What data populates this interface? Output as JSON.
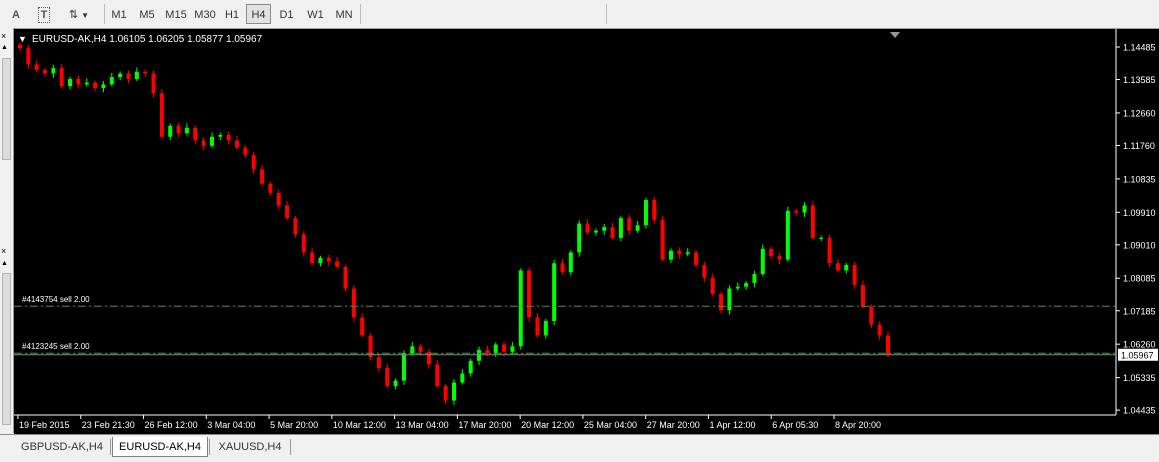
{
  "toolbar": {
    "tools": [
      {
        "name": "text-tool",
        "glyph": "A"
      },
      {
        "name": "text-label-tool",
        "glyph": "T"
      },
      {
        "name": "arrows-tool",
        "glyph": "⇅"
      }
    ],
    "timeframes": [
      "M1",
      "M5",
      "M15",
      "M30",
      "H1",
      "H4",
      "D1",
      "W1",
      "MN"
    ],
    "active_timeframe": "H4"
  },
  "chart": {
    "header": "EURUSD-AK,H4  1.06105 1.06205 1.05877 1.05967",
    "current_price": "1.05967",
    "price_levels": [
      "1.14485",
      "1.13585",
      "1.12660",
      "1.11760",
      "1.10835",
      "1.09910",
      "1.09010",
      "1.08085",
      "1.07185",
      "1.06260",
      "1.05335",
      "1.04435"
    ],
    "time_labels": [
      "19 Feb 2015",
      "23 Feb 21:30",
      "26 Feb 12:00",
      "3 Mar 04:00",
      "5 Mar 20:00",
      "10 Mar 12:00",
      "13 Mar 04:00",
      "17 Mar 20:00",
      "20 Mar 12:00",
      "25 Mar 04:00",
      "27 Mar 20:00",
      "1 Apr 12:00",
      "6 Apr 05:30",
      "8 Apr 20:00"
    ],
    "orders": [
      {
        "label": "#4143754 sell 2.00",
        "price": 1.0731
      },
      {
        "label": "#4123245 sell 2.00",
        "price": 1.0601
      }
    ],
    "colors": {
      "bull": "#00ff00",
      "bear": "#ff0000",
      "background": "#000000",
      "grid": "#ffffff",
      "order_line": "#3c9b3c"
    }
  },
  "chart_data": {
    "type": "candlestick",
    "symbol": "EURUSD-AK",
    "timeframe": "H4",
    "ylim": [
      1.043,
      1.149
    ],
    "series": [
      {
        "name": "close",
        "values": [
          1.1445,
          1.14,
          1.1385,
          1.1375,
          1.139,
          1.134,
          1.136,
          1.1345,
          1.135,
          1.1335,
          1.1345,
          1.1365,
          1.1375,
          1.136,
          1.138,
          1.1375,
          1.132,
          1.12,
          1.123,
          1.121,
          1.1225,
          1.119,
          1.1175,
          1.12,
          1.1205,
          1.119,
          1.117,
          1.115,
          1.111,
          1.107,
          1.1045,
          1.101,
          1.0975,
          1.093,
          1.088,
          1.085,
          1.0865,
          1.0855,
          1.084,
          1.078,
          1.07,
          1.065,
          1.059,
          1.056,
          1.051,
          1.0525,
          1.06,
          1.062,
          1.0605,
          1.057,
          1.051,
          1.047,
          1.052,
          1.0545,
          1.058,
          1.061,
          1.06,
          1.0625,
          1.0605,
          1.062,
          1.083,
          1.07,
          1.065,
          1.069,
          1.085,
          1.0825,
          1.088,
          1.096,
          1.0935,
          1.094,
          1.095,
          1.092,
          1.0975,
          1.094,
          1.0955,
          1.1025,
          1.097,
          1.086,
          1.0885,
          1.0875,
          1.088,
          1.0845,
          1.081,
          1.0765,
          1.072,
          1.078,
          1.0785,
          1.0795,
          1.082,
          1.089,
          1.087,
          1.086,
          1.0995,
          1.099,
          1.101,
          1.092,
          1.092,
          1.085,
          1.083,
          1.0845,
          1.079,
          1.073,
          1.068,
          1.065,
          1.05967
        ]
      }
    ],
    "xlabels": [
      "19 Feb 2015",
      "23 Feb 21:30",
      "26 Feb 12:00",
      "3 Mar 04:00",
      "5 Mar 20:00",
      "10 Mar 12:00",
      "13 Mar 04:00",
      "17 Mar 20:00",
      "20 Mar 12:00",
      "25 Mar 04:00",
      "27 Mar 20:00",
      "1 Apr 12:00",
      "6 Apr 05:30",
      "8 Apr 20:00"
    ],
    "yticks": [
      1.14485,
      1.13585,
      1.1266,
      1.1176,
      1.10835,
      1.0991,
      1.0901,
      1.08085,
      1.07185,
      1.0626,
      1.05335,
      1.04435
    ]
  },
  "tabs": [
    {
      "label": "GBPUSD-AK,H4",
      "active": false
    },
    {
      "label": "EURUSD-AK,H4",
      "active": true
    },
    {
      "label": "XAUUSD,H4",
      "active": false
    }
  ]
}
